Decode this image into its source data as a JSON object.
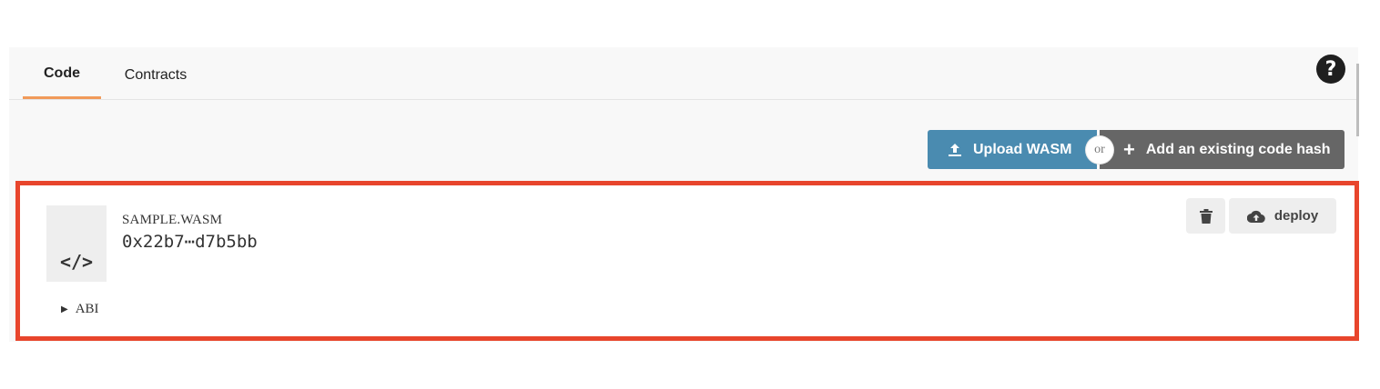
{
  "tabs": [
    {
      "label": "Code",
      "active": true
    },
    {
      "label": "Contracts",
      "active": false
    }
  ],
  "help_icon": "question-circle-icon",
  "actions": {
    "upload_label": "Upload WASM",
    "or_label": "or",
    "add_hash_label": "Add an existing code hash"
  },
  "code_card": {
    "name": "SAMPLE.WASM",
    "hash": "0x22b7⋯d7b5bb",
    "thumb_glyph": "</>",
    "abi_label": "ABI",
    "deploy_label": "deploy"
  },
  "colors": {
    "accent_tab": "#f19a5a",
    "upload_button": "#4a8bb0",
    "add_hash_button": "#666666",
    "highlight_border": "#e8452c"
  }
}
